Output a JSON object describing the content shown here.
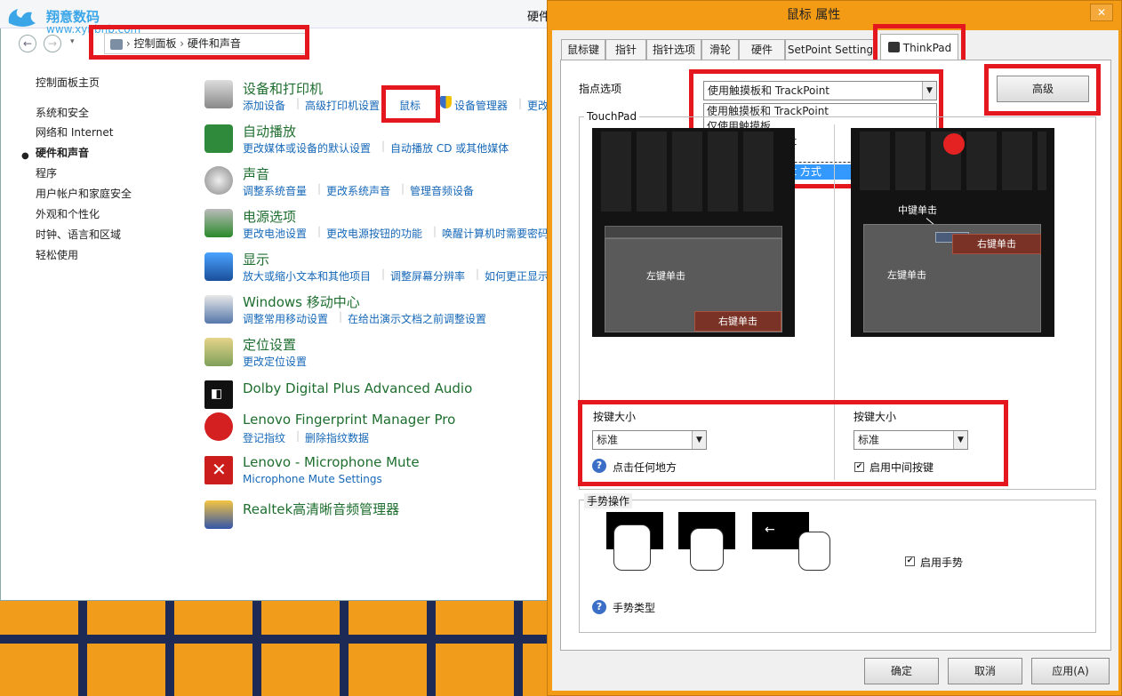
{
  "control_panel": {
    "title_partial": "硬件",
    "watermark": {
      "name": "翔意数码",
      "url": "www.xynbnb.com"
    },
    "breadcrumb": [
      "控制面板",
      "硬件和声音"
    ],
    "left_nav": [
      "控制面板主页",
      "系统和安全",
      "网络和 Internet",
      "硬件和声音",
      "程序",
      "用户帐户和家庭安全",
      "外观和个性化",
      "时钟、语言和区域",
      "轻松使用"
    ],
    "categories": [
      {
        "title": "设备和打印机",
        "links": [
          "添加设备",
          "高级打印机设置",
          "鼠标",
          "设备管理器",
          "更改"
        ]
      },
      {
        "title": "自动播放",
        "links": [
          "更改媒体或设备的默认设置",
          "自动播放 CD 或其他媒体"
        ]
      },
      {
        "title": "声音",
        "links": [
          "调整系统音量",
          "更改系统声音",
          "管理音频设备"
        ]
      },
      {
        "title": "电源选项",
        "links": [
          "更改电池设置",
          "更改电源按钮的功能",
          "唤醒计算机时需要密码"
        ]
      },
      {
        "title": "显示",
        "links": [
          "放大或缩小文本和其他项目",
          "调整屏幕分辨率",
          "如何更正显示"
        ]
      },
      {
        "title": "Windows 移动中心",
        "links": [
          "调整常用移动设置",
          "在给出演示文档之前调整设置"
        ]
      },
      {
        "title": "定位设置",
        "links": [
          "更改定位设置"
        ]
      },
      {
        "title": "Dolby Digital Plus Advanced Audio",
        "links": []
      },
      {
        "title": "Lenovo Fingerprint Manager Pro",
        "links": [
          "登记指纹",
          "删除指纹数据"
        ]
      },
      {
        "title": "Lenovo - Microphone Mute",
        "links": [
          "Microphone Mute Settings"
        ]
      },
      {
        "title": "Realtek高清晰音频管理器",
        "links": []
      }
    ]
  },
  "dialog": {
    "title": "鼠标 属性",
    "close": "✕",
    "tabs": [
      "鼠标键",
      "指针",
      "指针选项",
      "滑轮",
      "硬件",
      "SetPoint Setting",
      "ThinkPad"
    ],
    "pointing_label": "指点选项",
    "pointing_value": "使用触摸板和 TrackPoint",
    "dropdown_options": [
      "使用触摸板和 TrackPoint",
      "仅使用触摸板",
      "仅使用 TrackPoint",
      "仅经典 TrackPoint 方式"
    ],
    "advanced_button": "高级",
    "touchpad_group": "TouchPad",
    "left_click": "左键单击",
    "right_click": "右键单击",
    "middle_click": "中键单击",
    "button_size_label": "按键大小",
    "size_value": "标准",
    "click_anywhere": "点击任何地方",
    "enable_middle": "启用中间按键",
    "gesture_group": "手势操作",
    "enable_gestures": "启用手势",
    "gesture_type": "手势类型",
    "ok": "确定",
    "cancel": "取消",
    "apply": "应用(A)"
  },
  "colors": {
    "accent_red": "#e3171d",
    "link_blue": "#1668b8",
    "title_green": "#1e6e2f",
    "window_orange": "#f49b16"
  }
}
